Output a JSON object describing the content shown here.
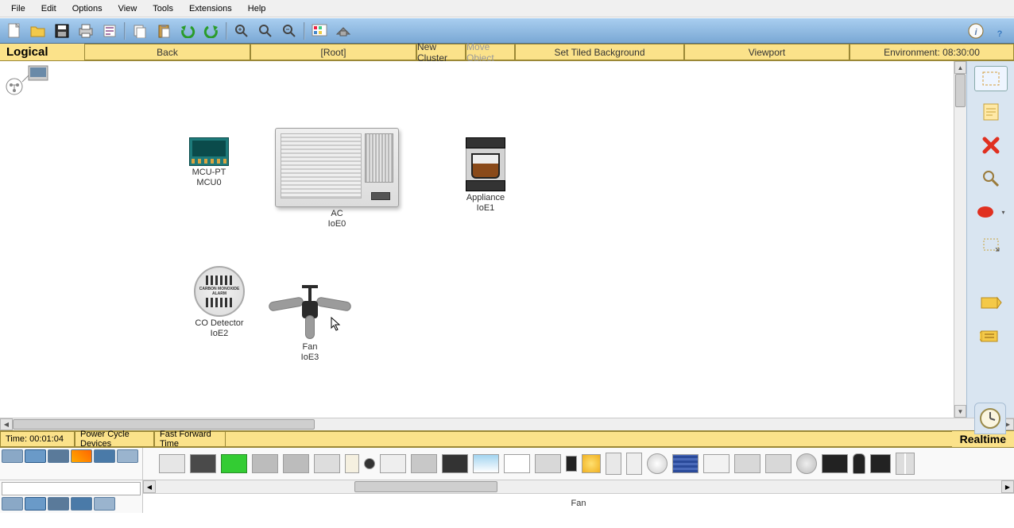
{
  "menu": [
    "File",
    "Edit",
    "Options",
    "View",
    "Tools",
    "Extensions",
    "Help"
  ],
  "secbar": {
    "logical": "Logical",
    "back": "Back",
    "root": "[Root]",
    "new_cluster": "New Cluster",
    "move_object": "Move Object",
    "tiled_bg": "Set Tiled Background",
    "viewport": "Viewport",
    "environment": "Environment: 08:30:00"
  },
  "devices": {
    "mcu": {
      "line1": "MCU-PT",
      "line2": "MCU0"
    },
    "ac": {
      "line1": "AC",
      "line2": "IoE0"
    },
    "appliance": {
      "line1": "Appliance",
      "line2": "IoE1"
    },
    "co": {
      "line1": "CO Detector",
      "line2": "IoE2"
    },
    "co_text": "CARBON MONOXIDE\nALARM",
    "fan": {
      "line1": "Fan",
      "line2": "IoE3"
    }
  },
  "timeline": {
    "time": "Time: 00:01:04",
    "power": "Power Cycle Devices",
    "fast": "Fast Forward Time",
    "realtime": "Realtime"
  },
  "status_selected": "Fan",
  "search_placeholder": ""
}
